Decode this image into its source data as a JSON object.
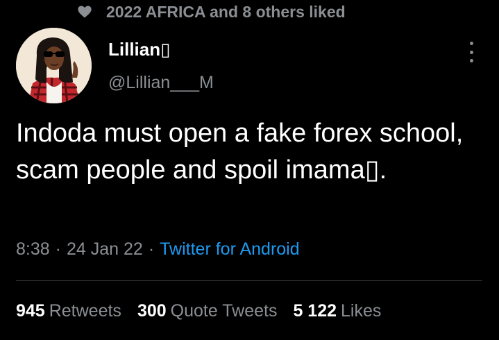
{
  "social_context": {
    "icon": "heart-icon",
    "text": "2022 AFRICA and 8 others liked"
  },
  "author": {
    "name": "Lillian▯",
    "handle": "@Lillian___M"
  },
  "tweet": {
    "text": "Indoda must open a fake forex school, scam people and spoil imama▯."
  },
  "meta": {
    "time": "8:38",
    "separator": "·",
    "date": "24 Jan 22",
    "source": "Twitter for Android"
  },
  "stats": {
    "retweets_count": "945",
    "retweets_label": "Retweets",
    "quotes_count": "300",
    "quotes_label": "Quote Tweets",
    "likes_count": "5 122",
    "likes_label": "Likes"
  },
  "colors": {
    "background": "#000000",
    "text": "#ffffff",
    "muted": "#8b8f93",
    "link": "#1d9bf0",
    "divider": "#2f3336"
  }
}
